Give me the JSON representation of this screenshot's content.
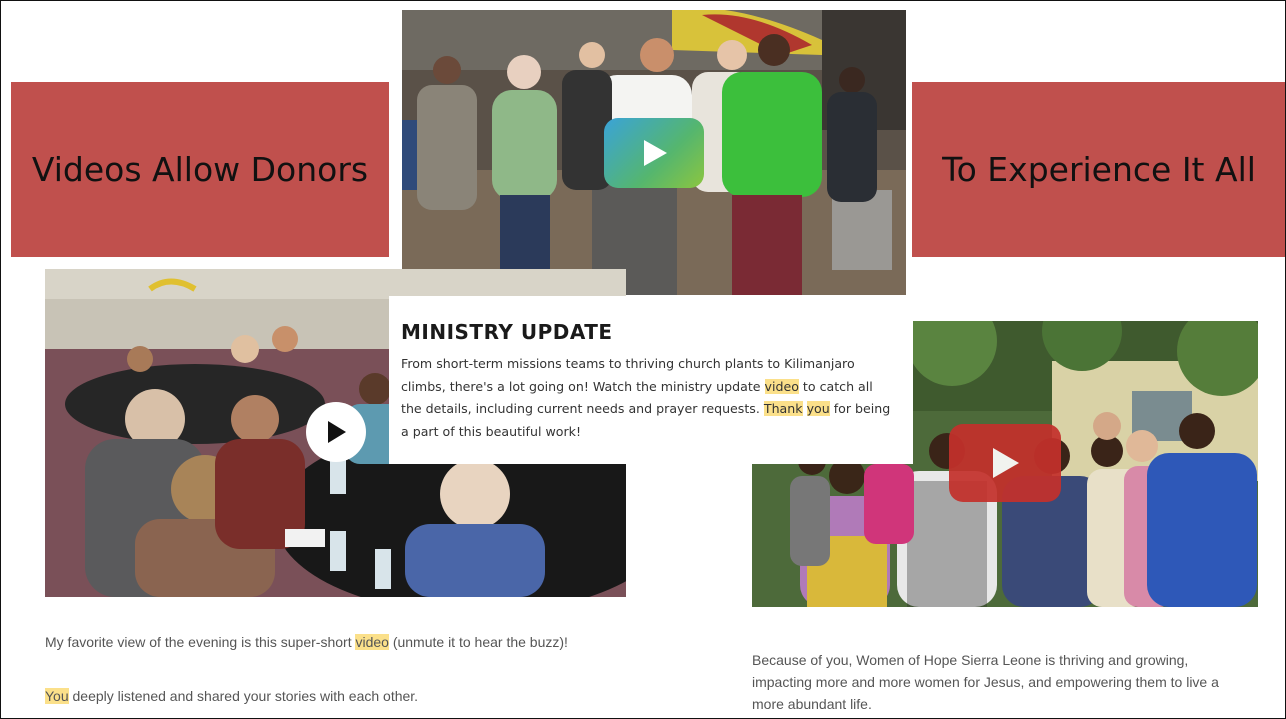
{
  "banners": {
    "left": "Videos Allow Donors",
    "right": "To Experience It All"
  },
  "ministry": {
    "title": "MINISTRY UPDATE",
    "p1": "From short-term missions teams to thriving church plants to Kilimanjaro climbs, there's a lot going on! Watch the ministry update ",
    "p1_hl_video": "video",
    "p2": " to catch all the details, including current needs and prayer requests. ",
    "p2_hl_thank": "Thank",
    "p2_space": " ",
    "p2_hl_you": "you",
    "p3": " for being a part of this beautiful work!"
  },
  "left_caption": {
    "line1_a": "My favorite view of the evening is this super-short ",
    "line1_hl": "video",
    "line1_b": " (unmute it to hear the buzz)!",
    "line2_hl": "You",
    "line2_b": " deeply listened and shared your stories with each other."
  },
  "right_caption": {
    "text": "Because of you, Women of Hope Sierra Leone is thriving and growing, impacting more and more women for Jesus, and empowering them to live a more abundant life."
  },
  "icons": {
    "play": "play-icon"
  },
  "colors": {
    "banner": "#c0504d",
    "highlight": "#fbe08a",
    "youtube_red": "#c4302b"
  }
}
